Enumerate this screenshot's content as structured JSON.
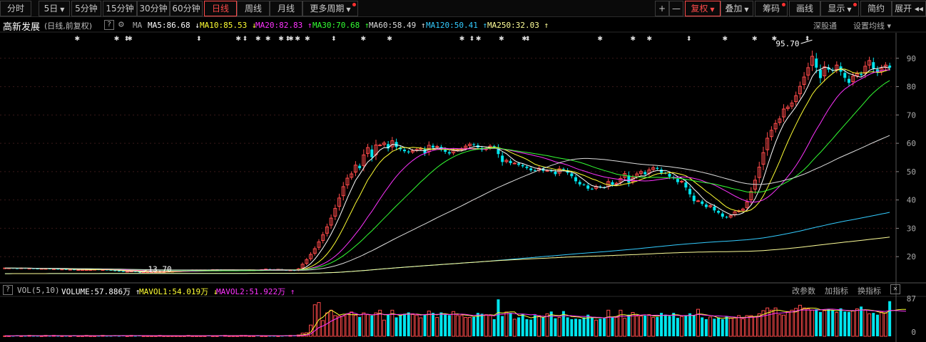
{
  "toolbar": {
    "left": [
      {
        "label": "分时",
        "x": 0,
        "w": 44
      },
      {
        "label": "5日",
        "x": 54,
        "w": 44,
        "caret": true
      },
      {
        "label": "5分钟",
        "x": 100,
        "w": 42
      },
      {
        "label": "15分钟",
        "x": 144,
        "w": 48
      },
      {
        "label": "30分钟",
        "x": 192,
        "w": 46
      },
      {
        "label": "60分钟",
        "x": 238,
        "w": 46
      },
      {
        "label": "日线",
        "x": 286,
        "w": 46,
        "active": true
      },
      {
        "label": "周线",
        "x": 332,
        "w": 46
      },
      {
        "label": "月线",
        "x": 378,
        "w": 46
      },
      {
        "label": "更多周期",
        "x": 424,
        "w": 78,
        "caret": true,
        "dot": true
      }
    ],
    "right": [
      {
        "label": "+",
        "x": 918,
        "w": 20
      },
      {
        "label": "—",
        "x": 938,
        "w": 20
      },
      {
        "label": "复权",
        "x": 960,
        "w": 50,
        "caret": true,
        "active": true
      },
      {
        "label": "叠加",
        "x": 1010,
        "w": 46,
        "caret": true
      },
      {
        "label": "筹码",
        "x": 1058,
        "w": 46,
        "dot": true
      },
      {
        "label": "画线",
        "x": 1106,
        "w": 44
      },
      {
        "label": "显示",
        "x": 1150,
        "w": 54,
        "caret": true,
        "dot": true
      },
      {
        "label": "简约",
        "x": 1206,
        "w": 44
      },
      {
        "label": "展开 ◂◂",
        "x": 1250,
        "w": 48
      }
    ]
  },
  "info": {
    "stock_name": "高新发展",
    "mode": "(日线,前复权)",
    "help_icon": "?",
    "ma_label": "MA",
    "ma": [
      {
        "label": "MA5:86.68",
        "arrow": "↓",
        "color": "#ffffff",
        "x": 207
      },
      {
        "label": "MA10:85.53",
        "arrow": "↓",
        "color": "#ffff33",
        "x": 280
      },
      {
        "label": "MA20:82.83",
        "arrow": "↑",
        "color": "#ff33ff",
        "x": 358
      },
      {
        "label": "MA30:70.68",
        "arrow": "↑",
        "color": "#33ff33",
        "x": 438
      },
      {
        "label": "MA60:58.49",
        "arrow": "↑",
        "color": "#dddddd",
        "x": 517
      },
      {
        "label": "MA120:50.41",
        "arrow": "↑",
        "color": "#33ccff",
        "x": 597
      },
      {
        "label": "MA250:32.03",
        "arrow": "↑",
        "color": "#ffff99",
        "x": 683
      }
    ],
    "exchange": "深股通",
    "set_ma": "设置均线"
  },
  "vol": {
    "help_icon": "?",
    "name": "VOL(5,10)",
    "volume": "VOLUME:57.886万",
    "volume_arrow": "↑",
    "mavol1": "MAVOL1:54.019万",
    "mavol1_arrow": "↓",
    "mavol2": "MAVOL2:51.922万",
    "mavol2_arrow": "↑",
    "change_params": "改参数",
    "add_indicator": "加指标",
    "switch_indicator": "换指标",
    "close_icon": "✕"
  },
  "colors": {
    "up": "#ff4a4a",
    "down": "#00e5ee",
    "ma5": "#ffffff",
    "ma10": "#ffff33",
    "ma20": "#ff33ff",
    "ma30": "#33ff33",
    "ma60": "#dddddd",
    "ma120": "#33ccff",
    "ma250": "#ffff99"
  },
  "chart_data": {
    "type": "candlestick",
    "y_ticks": [
      20,
      30,
      40,
      50,
      60,
      70,
      80,
      90
    ],
    "ylim": [
      11,
      99
    ],
    "vol_ticks": [
      "87",
      "0"
    ],
    "vol_max": 87,
    "high_annotation": "95.70",
    "low_annotation": "13.70",
    "candles_count": 250,
    "close": [
      16.0,
      16.0,
      15.9,
      15.8,
      16.0,
      15.9,
      15.9,
      15.8,
      15.7,
      15.8,
      15.8,
      15.7,
      15.7,
      15.6,
      15.6,
      15.5,
      15.5,
      15.4,
      15.4,
      15.4,
      15.4,
      15.4,
      15.5,
      15.4,
      15.4,
      15.3,
      15.2,
      15.0,
      14.9,
      14.8,
      14.8,
      14.9,
      14.7,
      14.6,
      14.6,
      14.6,
      14.6,
      14.6,
      14.6,
      14.6,
      14.8,
      14.8,
      15.0,
      15.0,
      15.2,
      15.2,
      15.3,
      15.3,
      15.3,
      15.3,
      15.2,
      15.4,
      15.4,
      15.3,
      15.3,
      15.3,
      15.3,
      15.3,
      15.3,
      15.3,
      15.3,
      15.3,
      15.2,
      15.4,
      15.6,
      15.5,
      15.3,
      15.5,
      15.3,
      15.2,
      15.3,
      15.1,
      15.7,
      17.3,
      18.9,
      20.8,
      22.8,
      25.2,
      27.7,
      30.5,
      33.6,
      37.0,
      40.7,
      44.7,
      47.7,
      49.2,
      52.3,
      51.2,
      55.9,
      58.5,
      55.1,
      59.4,
      59.4,
      60.1,
      58.2,
      60.9,
      58.7,
      57.9,
      57.2,
      56.8,
      57.4,
      57.8,
      58.2,
      56.5,
      59.3,
      58.5,
      58.9,
      57.9,
      57.0,
      56.4,
      57.5,
      57.6,
      58.1,
      59.0,
      59.7,
      59.5,
      58.5,
      57.7,
      58.2,
      59.0,
      58.9,
      56.2,
      53.4,
      54.0,
      53.0,
      53.0,
      52.4,
      51.9,
      51.3,
      50.5,
      50.3,
      51.2,
      50.3,
      50.4,
      50.2,
      49.1,
      51.0,
      50.7,
      49.6,
      48.4,
      46.6,
      45.5,
      45.4,
      44.0,
      43.9,
      44.8,
      44.5,
      44.3,
      46.5,
      45.4,
      45.9,
      47.6,
      49.3,
      46.1,
      47.9,
      49.2,
      50.0,
      49.1,
      50.6,
      51.4,
      51.0,
      49.6,
      49.5,
      48.2,
      47.7,
      46.3,
      46.6,
      44.4,
      42.0,
      39.6,
      39.7,
      38.6,
      37.5,
      38.0,
      36.3,
      35.5,
      34.1,
      33.8,
      34.5,
      35.8,
      36.2,
      36.8,
      39.3,
      43.0,
      47.0,
      51.6,
      56.7,
      61.8,
      64.6,
      67.0,
      68.6,
      72.1,
      72.8,
      74.2,
      76.8,
      80.1,
      83.4,
      86.7,
      90.7,
      86.7,
      83.0,
      87.0,
      86.0,
      85.7,
      87.6,
      85.3,
      83.1,
      81.3,
      83.7,
      84.6,
      84.1,
      87.2,
      89.2,
      86.4,
      84.9,
      86.5,
      87.6,
      86.7
    ],
    "volume": [
      1,
      1,
      1,
      2,
      1,
      1,
      2,
      1,
      1,
      1,
      2,
      1,
      2,
      1,
      1,
      1,
      1,
      2,
      1,
      1,
      2,
      1,
      1,
      1,
      2,
      1,
      1,
      2,
      1,
      2,
      1,
      2,
      1,
      2,
      1,
      1,
      1,
      1,
      2,
      1,
      1,
      1,
      1,
      1,
      1,
      2,
      1,
      1,
      1,
      1,
      2,
      1,
      1,
      2,
      2,
      1,
      1,
      1,
      2,
      2,
      1,
      1,
      2,
      1,
      1,
      1,
      1,
      1,
      1,
      2,
      2,
      2,
      3,
      7,
      8,
      25,
      70,
      75,
      35,
      52,
      58,
      46,
      45,
      45,
      50,
      54,
      47,
      43,
      52,
      48,
      46,
      52,
      58,
      36,
      48,
      58,
      42,
      47,
      50,
      53,
      50,
      47,
      41,
      47,
      56,
      52,
      42,
      53,
      48,
      47,
      55,
      46,
      46,
      42,
      42,
      43,
      52,
      50,
      48,
      46,
      38,
      82,
      45,
      54,
      52,
      38,
      42,
      50,
      38,
      37,
      47,
      46,
      42,
      50,
      55,
      40,
      42,
      56,
      42,
      38,
      39,
      38,
      42,
      48,
      42,
      36,
      39,
      40,
      58,
      42,
      42,
      58,
      40,
      48,
      53,
      45,
      45,
      46,
      48,
      42,
      43,
      52,
      48,
      45,
      52,
      41,
      44,
      46,
      51,
      47,
      60,
      42,
      38,
      43,
      39,
      42,
      38,
      44,
      40,
      41,
      46,
      39,
      46,
      46,
      44,
      50,
      57,
      63,
      58,
      63,
      48,
      47,
      55,
      58,
      62,
      69,
      63,
      61,
      58,
      60,
      54,
      57,
      61,
      58,
      53,
      62,
      55,
      54,
      57,
      61,
      66,
      58,
      50,
      52,
      48,
      54,
      52,
      78,
      55,
      56,
      58,
      52
    ]
  }
}
